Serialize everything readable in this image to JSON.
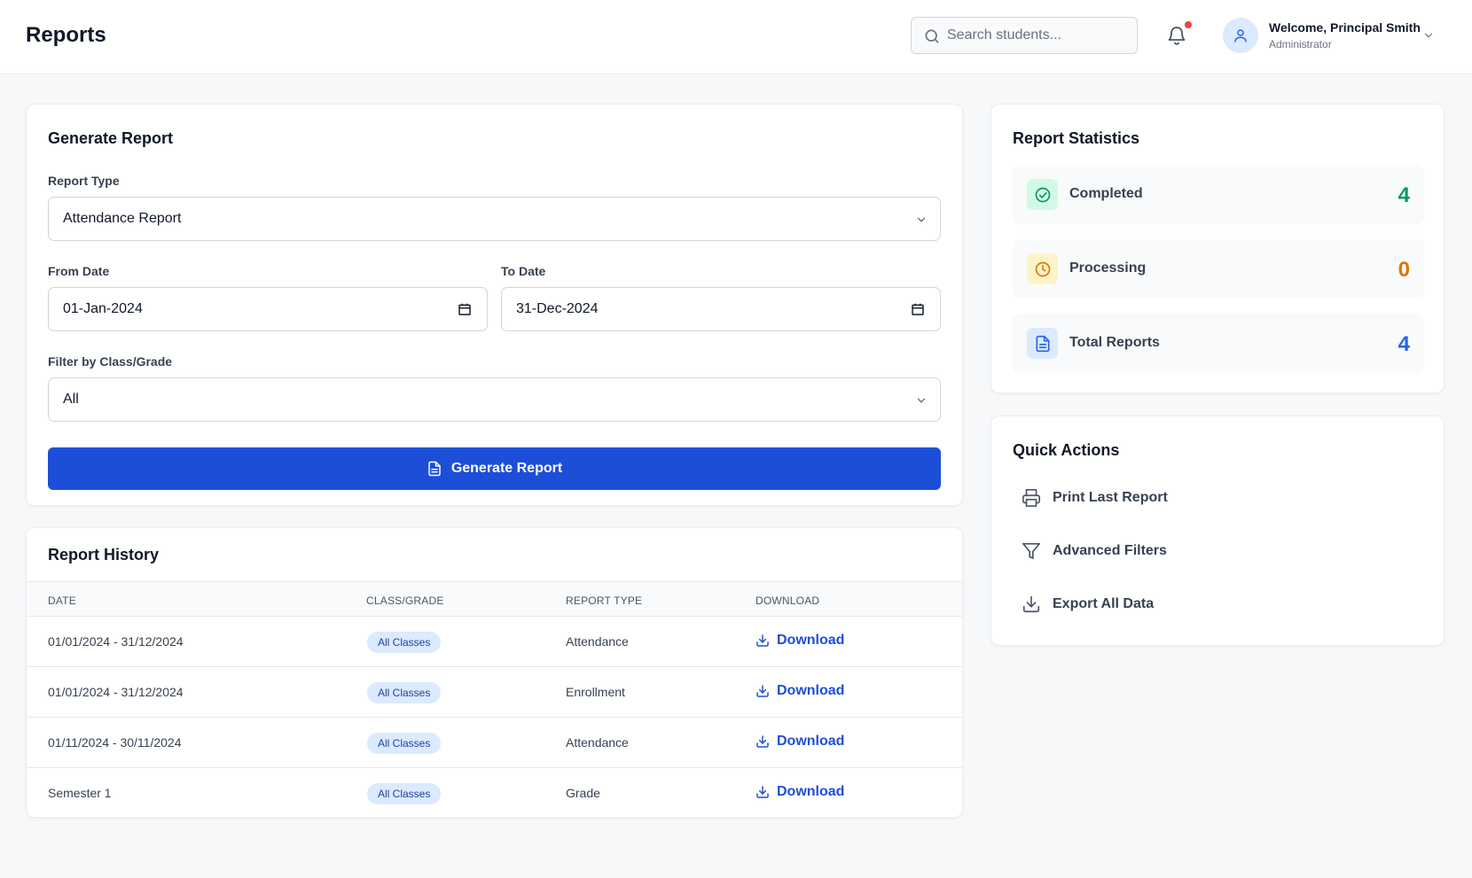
{
  "header": {
    "title": "Reports",
    "search_placeholder": "Search students...",
    "user_name": "Welcome, Principal Smith",
    "user_role": "Administrator"
  },
  "generate": {
    "title": "Generate Report",
    "report_type_label": "Report Type",
    "report_type_value": "Attendance Report",
    "from_label": "From Date",
    "from_value": "01-Jan-2024",
    "to_label": "To Date",
    "to_value": "31-Dec-2024",
    "filter_label": "Filter by Class/Grade",
    "filter_value": "All",
    "button_label": "Generate Report"
  },
  "history": {
    "title": "Report History",
    "columns": [
      "DATE",
      "CLASS/GRADE",
      "REPORT TYPE",
      "DOWNLOAD"
    ],
    "rows": [
      {
        "date": "01/01/2024 - 31/12/2024",
        "class": "All Classes",
        "type": "Attendance",
        "download": "Download"
      },
      {
        "date": "01/01/2024 - 31/12/2024",
        "class": "All Classes",
        "type": "Enrollment",
        "download": "Download"
      },
      {
        "date": "01/11/2024 - 30/11/2024",
        "class": "All Classes",
        "type": "Attendance",
        "download": "Download"
      },
      {
        "date": "Semester 1",
        "class": "All Classes",
        "type": "Grade",
        "download": "Download"
      }
    ]
  },
  "stats": {
    "title": "Report Statistics",
    "items": [
      {
        "label": "Completed",
        "value": "4",
        "color": "#059669",
        "icon_bg": "#d1fae5",
        "icon": "check-circle-icon"
      },
      {
        "label": "Processing",
        "value": "0",
        "color": "#d97706",
        "icon_bg": "#fef3c7",
        "icon": "clock-icon"
      },
      {
        "label": "Total Reports",
        "value": "4",
        "color": "#2563eb",
        "icon_bg": "#dbeafe",
        "icon": "document-icon"
      }
    ]
  },
  "quick_actions": {
    "title": "Quick Actions",
    "items": [
      {
        "label": "Print Last Report",
        "icon": "printer-icon"
      },
      {
        "label": "Advanced Filters",
        "icon": "filter-icon"
      },
      {
        "label": "Export All Data",
        "icon": "download-icon"
      }
    ]
  },
  "colors": {
    "primary": "#1d4ed8",
    "notification_dot": "#ef4444",
    "badge_bg": "#dbeafe",
    "badge_text": "#1e40af"
  }
}
